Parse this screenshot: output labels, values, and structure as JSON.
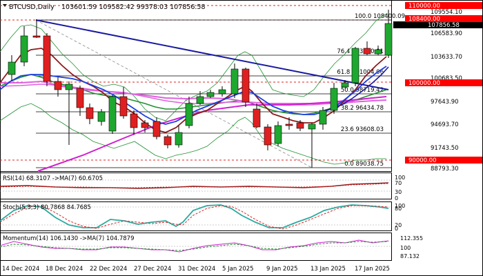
{
  "header": {
    "symbol_tf": "BTCUSD,Daily",
    "ohlc": "103601.59 109582.42 99378.03 107856.58"
  },
  "price_axis": {
    "labels": [
      "110000.00",
      "109554.10",
      "107856.58",
      "108400.00",
      "106583.90",
      "103633.70",
      "100683.50",
      "100000.00",
      "97643.90",
      "94693.70",
      "91743.50",
      "90000.00",
      "88793.30"
    ]
  },
  "fib_labels": {
    "f100": "100.0 108400.09",
    "f764": "76.4 103830.81",
    "f618": "61.8 101004.06",
    "f500": "50.0 98719.42",
    "f382": "38.2 96434.78",
    "f236": "23.6 93608.03",
    "f0": "0.0 89038.75"
  },
  "rsi_panel": {
    "label": "RSI(14) 68.3107   ->MA(7) 60.6705",
    "ticks": [
      "100",
      "70",
      "30",
      "0"
    ]
  },
  "stoch_panel": {
    "label": "Stoch(5,3,3) 80.7868 84.7685",
    "ticks": [
      "100",
      "80",
      "20",
      "0"
    ]
  },
  "momentum_panel": {
    "label": "Momentum(14) 106.1430   ->MA(7) 104.7879",
    "ticks": [
      "112.355",
      "100",
      "87.132"
    ]
  },
  "date_axis": {
    "labels": [
      "14 Dec 2024",
      "18 Dec 2024",
      "22 Dec 2024",
      "27 Dec 2024",
      "31 Dec 2024",
      "5 Jan 2025",
      "9 Jan 2025",
      "13 Jan 2025",
      "17 Jan 2025"
    ]
  },
  "colors": {
    "bull": "#1ea82f",
    "bear": "#e02020",
    "trendline": "#1a1aa0",
    "sma_short": "#1a3fe0",
    "ema_red": "#8b1a1a",
    "sma_green": "#1f8f2f",
    "pink": "#e060e0",
    "support_red": "#ff0000"
  }
}
